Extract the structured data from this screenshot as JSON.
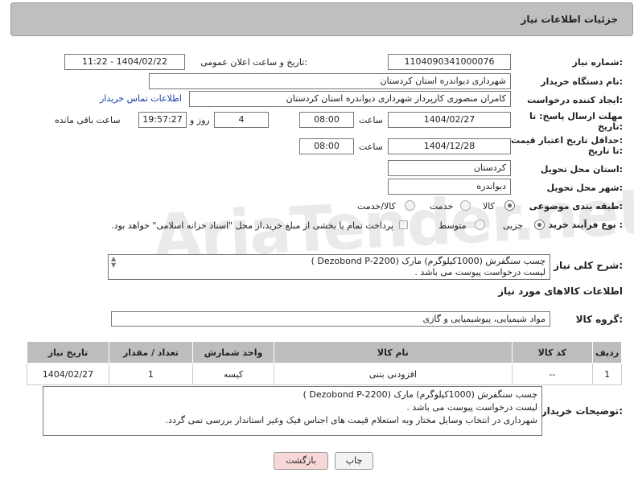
{
  "page": {
    "title": "جزئیات اطلاعات نیاز"
  },
  "form": {
    "need_number_label": "شماره نیاز:",
    "need_number": "1104090341000076",
    "announce_label": "تاریخ و ساعت اعلان عمومی:",
    "announce_value": "1404/02/22 - 11:22",
    "buyer_org_label": "نام دستگاه خریدار:",
    "buyer_org": "شهرداری دیواندره استان کردستان",
    "creator_label": "ایجاد کننده درخواست:",
    "creator": "کامران منصوری کارپرداز شهرداری دیواندره استان کردستان",
    "contact_link": "اطلاعات تماس خریدار",
    "deadline_label_1": "مهلت ارسال پاسخ: تا",
    "deadline_label_2": "تاریخ:",
    "deadline_date": "1404/02/27",
    "time_label": "ساعت",
    "deadline_time": "08:00",
    "days_value": "4",
    "days_label": "روز و",
    "remaining_time": "19:57:27",
    "remaining_label": "ساعت باقی مانده",
    "validity_label_1": "حداقل تاریخ اعتبار قیمت:",
    "validity_label_2": "تا تاریخ:",
    "validity_date": "1404/12/28",
    "validity_time": "08:00",
    "province_label": "استان محل تحویل:",
    "province": "کردستان",
    "city_label": "شهر محل تحویل:",
    "city": "دیواندره",
    "category_label": "طبقه بندی موضوعی:",
    "category_options": [
      "کالا",
      "خدمت",
      "کالا/خدمت"
    ],
    "category_selected": "کالا",
    "process_label": "نوع فرآیند خرید :",
    "process_options": [
      "جزیی",
      "متوسط"
    ],
    "process_selected": "جزیی",
    "treasury_note": "پرداخت تمام یا بخشی از مبلغ خرید،از محل \"اسناد خزانه اسلامی\" خواهد بود.",
    "summary_label": "شرح کلی نیاز:",
    "summary_line1": "چسب سنگفرش (1000کیلوگرم) مارک (Dezobond P-2200 )",
    "summary_line2": "لیست درخواست پیوست می باشد ."
  },
  "goods": {
    "section_title": "اطلاعات کالاهای مورد نیاز",
    "group_label": "گروه کالا:",
    "group_value": "مواد شیمیایی، پیوشیمیایی و  گازی",
    "columns": [
      "ردیف",
      "کد کالا",
      "نام کالا",
      "واحد شمارش",
      "تعداد / مقدار",
      "تاریخ نیاز"
    ],
    "rows": [
      {
        "row": "1",
        "code": "--",
        "name": "افزودنی بتنی",
        "unit": "کیسه",
        "qty": "1",
        "date": "1404/02/27"
      }
    ]
  },
  "buyer_notes": {
    "label": "توضیحات خریدار:",
    "line1": "چسب سنگفرش (1000کیلوگرم) مارک (Dezobond P-2200 )",
    "line2": "لیست درخواست پیوست می باشد .",
    "line3": "شهرداری در انتخاب وسایل مختار وبه استعلام قیمت های اجناس فیک وغیر استاندار بررسی نمی گردد."
  },
  "buttons": {
    "print": "چاپ",
    "back": "بازگشت"
  },
  "watermark": "AriaTender.net",
  "colors": {
    "header_bg": "#bfbfbf",
    "link": "#1a3fa8",
    "back_button_bg": "#f8d7d7"
  }
}
